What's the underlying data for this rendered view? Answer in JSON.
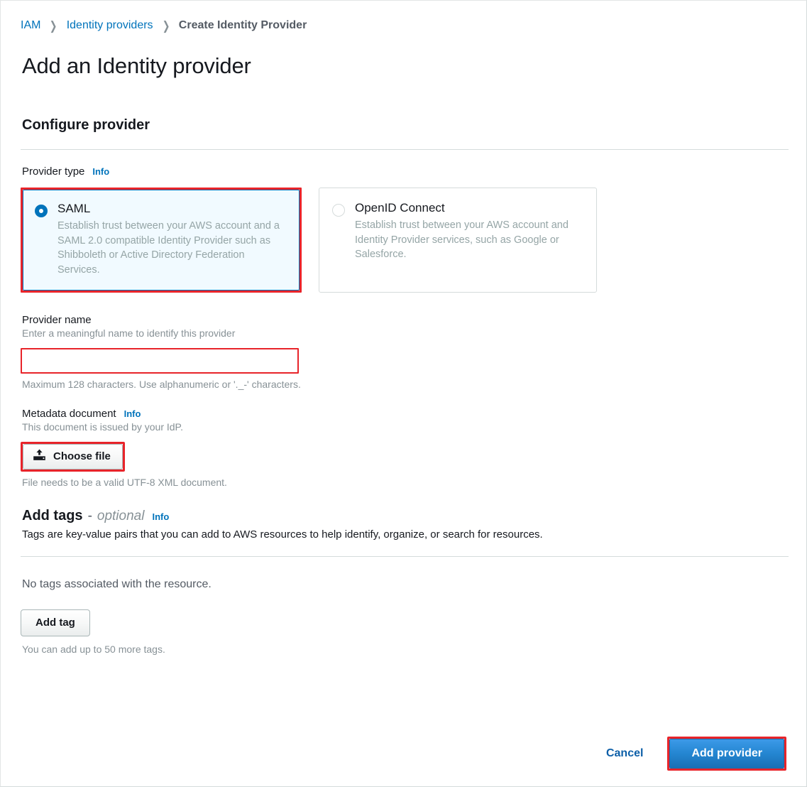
{
  "breadcrumb": {
    "items": [
      {
        "label": "IAM",
        "current": false
      },
      {
        "label": "Identity providers",
        "current": false
      },
      {
        "label": "Create Identity Provider",
        "current": true
      }
    ],
    "separator": "❯"
  },
  "page": {
    "title": "Add an Identity provider",
    "section_title": "Configure provider"
  },
  "provider_type": {
    "label": "Provider type",
    "info": "Info",
    "options": [
      {
        "id": "saml",
        "title": "SAML",
        "description": "Establish trust between your AWS account and a SAML 2.0 compatible Identity Provider such as Shibboleth or Active Directory Federation Services.",
        "selected": true
      },
      {
        "id": "oidc",
        "title": "OpenID Connect",
        "description": "Establish trust between your AWS account and Identity Provider services, such as Google or Salesforce.",
        "selected": false
      }
    ]
  },
  "provider_name": {
    "label": "Provider name",
    "description": "Enter a meaningful name to identify this provider",
    "value": "",
    "placeholder": "",
    "hint": "Maximum 128 characters. Use alphanumeric or '._-' characters."
  },
  "metadata_document": {
    "label": "Metadata document",
    "info": "Info",
    "description": "This document is issued by your IdP.",
    "button_label": "Choose file",
    "button_icon": "upload-icon",
    "hint": "File needs to be a valid UTF-8 XML document."
  },
  "add_tags": {
    "title": "Add tags",
    "dash": "-",
    "optional": "optional",
    "info": "Info",
    "description": "Tags are key-value pairs that you can add to AWS resources to help identify, organize, or search for resources.",
    "empty_state": "No tags associated with the resource.",
    "add_tag_label": "Add tag",
    "limit_hint": "You can add up to 50 more tags."
  },
  "footer": {
    "cancel_label": "Cancel",
    "submit_label": "Add provider"
  },
  "colors": {
    "link_blue": "#0073bb",
    "highlight_red": "#e8242a",
    "primary_blue": "#2486d1",
    "selected_tile_bg": "#f1faff",
    "muted_text": "#879196"
  }
}
